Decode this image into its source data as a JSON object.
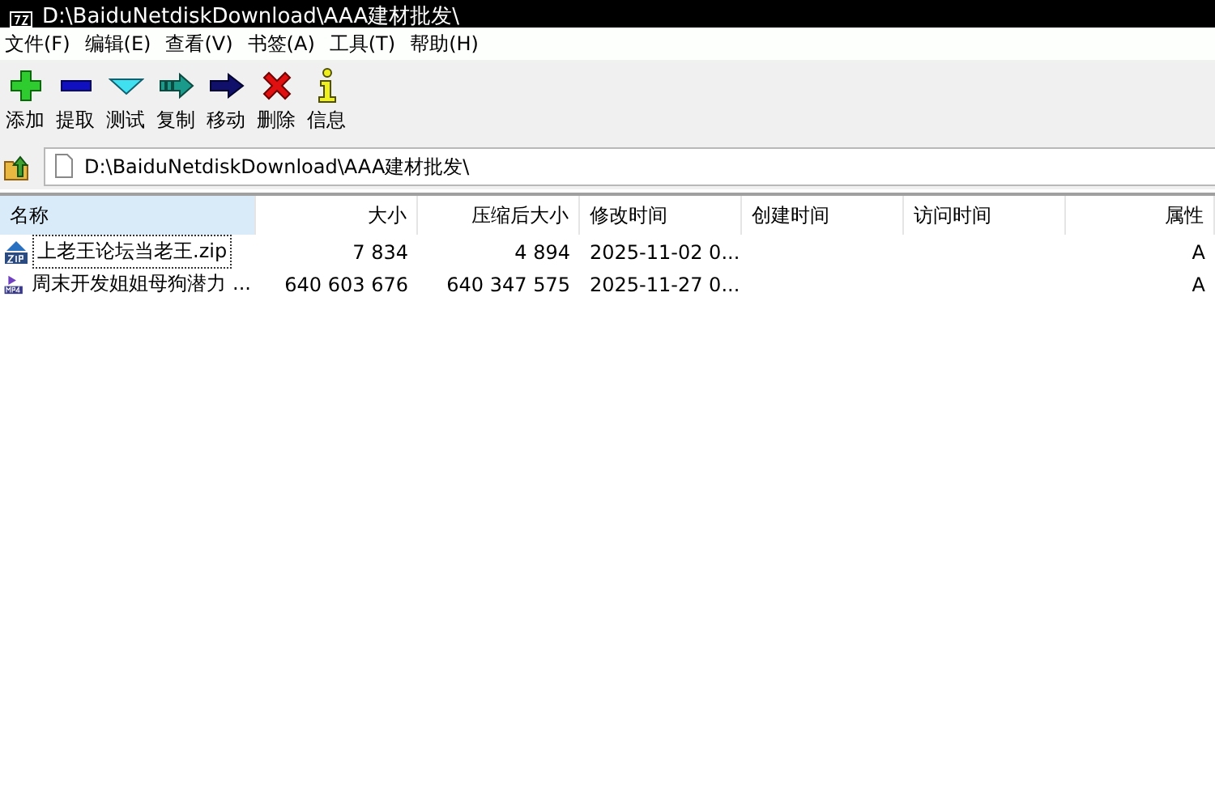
{
  "window": {
    "title": "D:\\BaiduNetdiskDownload\\AAA建材批发\\"
  },
  "menu": [
    "文件(F)",
    "编辑(E)",
    "查看(V)",
    "书签(A)",
    "工具(T)",
    "帮助(H)"
  ],
  "toolbar": [
    {
      "kind": "add",
      "label": "添加"
    },
    {
      "kind": "extract",
      "label": "提取"
    },
    {
      "kind": "test",
      "label": "测试"
    },
    {
      "kind": "copy",
      "label": "复制"
    },
    {
      "kind": "move",
      "label": "移动"
    },
    {
      "kind": "delete",
      "label": "删除"
    },
    {
      "kind": "info",
      "label": "信息"
    }
  ],
  "address": {
    "value": "D:\\BaiduNetdiskDownload\\AAA建材批发\\"
  },
  "table": {
    "columns": [
      {
        "label": "名称",
        "selected": true
      },
      {
        "label": "大小",
        "selected": false
      },
      {
        "label": "压缩后大小",
        "selected": false
      },
      {
        "label": "修改时间",
        "selected": false
      },
      {
        "label": "创建时间",
        "selected": false
      },
      {
        "label": "访问时间",
        "selected": false
      },
      {
        "label": "属性",
        "selected": false
      }
    ],
    "rows": [
      {
        "kind": "zip",
        "focused": true,
        "cells": [
          "上老王论坛当老王.zip",
          "7 834",
          "4 894",
          "2025-11-02 0...",
          "",
          "",
          "A"
        ]
      },
      {
        "kind": "mp4",
        "focused": false,
        "cells": [
          "周末开发姐姐母狗潜力 ...",
          "640 603 676",
          "640 347 575",
          "2025-11-27 0...",
          "",
          "",
          "A"
        ]
      }
    ]
  }
}
